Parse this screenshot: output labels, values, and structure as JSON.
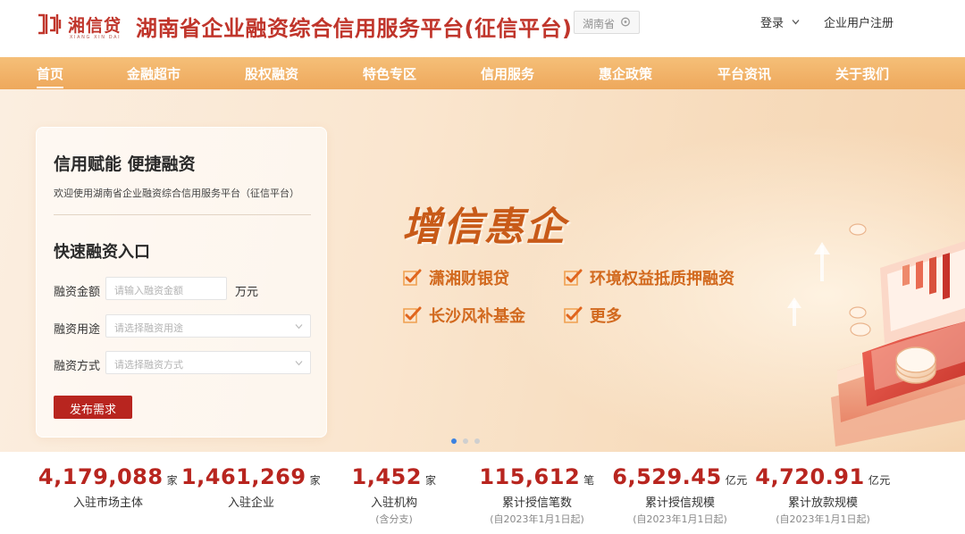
{
  "header": {
    "logo_cn": "湘信贷",
    "logo_en": "XIANG XIN DAI",
    "site_title": "湖南省企业融资综合信用服务平台(征信平台)",
    "region": "湖南省",
    "login": "登录",
    "register": "企业用户注册"
  },
  "nav": {
    "items": [
      {
        "label": "首页",
        "active": true
      },
      {
        "label": "金融超市"
      },
      {
        "label": "股权融资"
      },
      {
        "label": "特色专区"
      },
      {
        "label": "信用服务"
      },
      {
        "label": "惠企政策"
      },
      {
        "label": "平台资讯"
      },
      {
        "label": "关于我们"
      }
    ]
  },
  "banner": {
    "hero": "增信惠企",
    "features": [
      "潇湘财银贷",
      "环境权益抵质押融资",
      "长沙风补基金",
      "更多"
    ],
    "carousel_active": 1
  },
  "panel": {
    "title": "信用赋能 便捷融资",
    "subtitle": "欢迎使用湖南省企业融资综合信用服务平台（征信平台）",
    "quick_title": "快速融资入口",
    "amount_label": "融资金额",
    "amount_placeholder": "请输入融资金额",
    "amount_unit": "万元",
    "purpose_label": "融资用途",
    "purpose_placeholder": "请选择融资用途",
    "method_label": "融资方式",
    "method_placeholder": "请选择融资方式",
    "submit": "发布需求"
  },
  "stats": [
    {
      "value": "4,179,088",
      "unit": "家",
      "label": "入驻市场主体",
      "note": ""
    },
    {
      "value": "1,461,269",
      "unit": "家",
      "label": "入驻企业",
      "note": ""
    },
    {
      "value": "1,452",
      "unit": "家",
      "label": "入驻机构",
      "note": "(含分支)"
    },
    {
      "value": "115,612",
      "unit": "笔",
      "label": "累计授信笔数",
      "note": "(自2023年1月1日起)"
    },
    {
      "value": "6,529.45",
      "unit": "亿元",
      "label": "累计授信规模",
      "note": "(自2023年1月1日起)"
    },
    {
      "value": "4,720.91",
      "unit": "亿元",
      "label": "累计放款规模",
      "note": "(自2023年1月1日起)"
    }
  ],
  "colors": {
    "brand_red": "#b8251f",
    "nav_orange": "#eea85c",
    "feature_orange": "#d2691e"
  }
}
